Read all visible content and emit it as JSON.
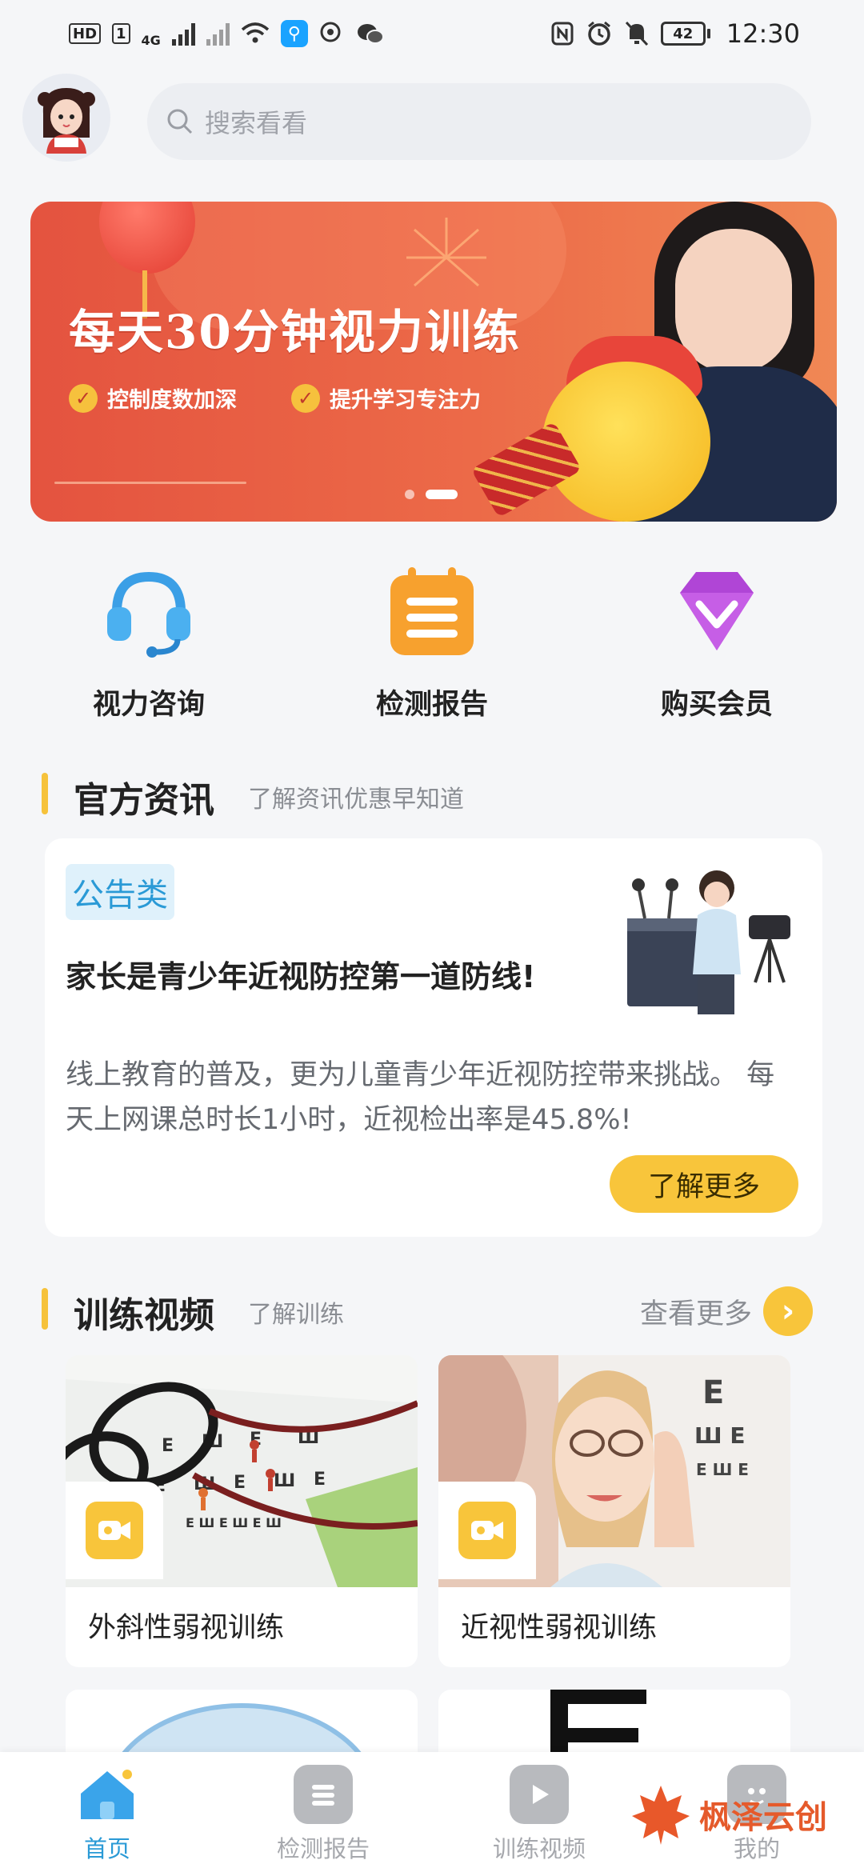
{
  "status_bar": {
    "hd": "HD",
    "sim": "1",
    "network": "4G",
    "battery": "42",
    "time": "12:30"
  },
  "search": {
    "placeholder": "搜索看看"
  },
  "banner": {
    "title": "每天30分钟视力训练",
    "features": [
      "控制度数加深",
      "提升学习专注力"
    ],
    "page_count": 2,
    "active_page": 2
  },
  "quick_actions": [
    {
      "label": "视力咨询",
      "icon": "headset-icon"
    },
    {
      "label": "检测报告",
      "icon": "report-icon"
    },
    {
      "label": "购买会员",
      "icon": "diamond-icon"
    }
  ],
  "news_section": {
    "title": "官方资讯",
    "subtitle": "了解资讯优惠早知道",
    "card": {
      "badge": "公告类",
      "headline": "家长是青少年近视防控第一道防线!",
      "body": "线上教育的普及，更为儿童青少年近视防控带来挑战。 每天上网课总时长1小时，近视检出率是45.8%!",
      "button": "了解更多"
    }
  },
  "video_section": {
    "title": "训练视频",
    "subtitle": "了解训练",
    "see_more": "查看更多",
    "videos": [
      {
        "title": "外斜性弱视训练"
      },
      {
        "title": "近视性弱视训练"
      }
    ]
  },
  "tab_bar": {
    "tabs": [
      {
        "label": "首页",
        "active": true
      },
      {
        "label": "检测报告",
        "active": false
      },
      {
        "label": "训练视频",
        "active": false
      },
      {
        "label": "我的",
        "active": false
      }
    ]
  },
  "watermark": {
    "text": "枫泽云创"
  },
  "colors": {
    "accent_yellow": "#f8c53b",
    "accent_blue": "#2a9ad6",
    "banner_red": "#e4533f"
  }
}
